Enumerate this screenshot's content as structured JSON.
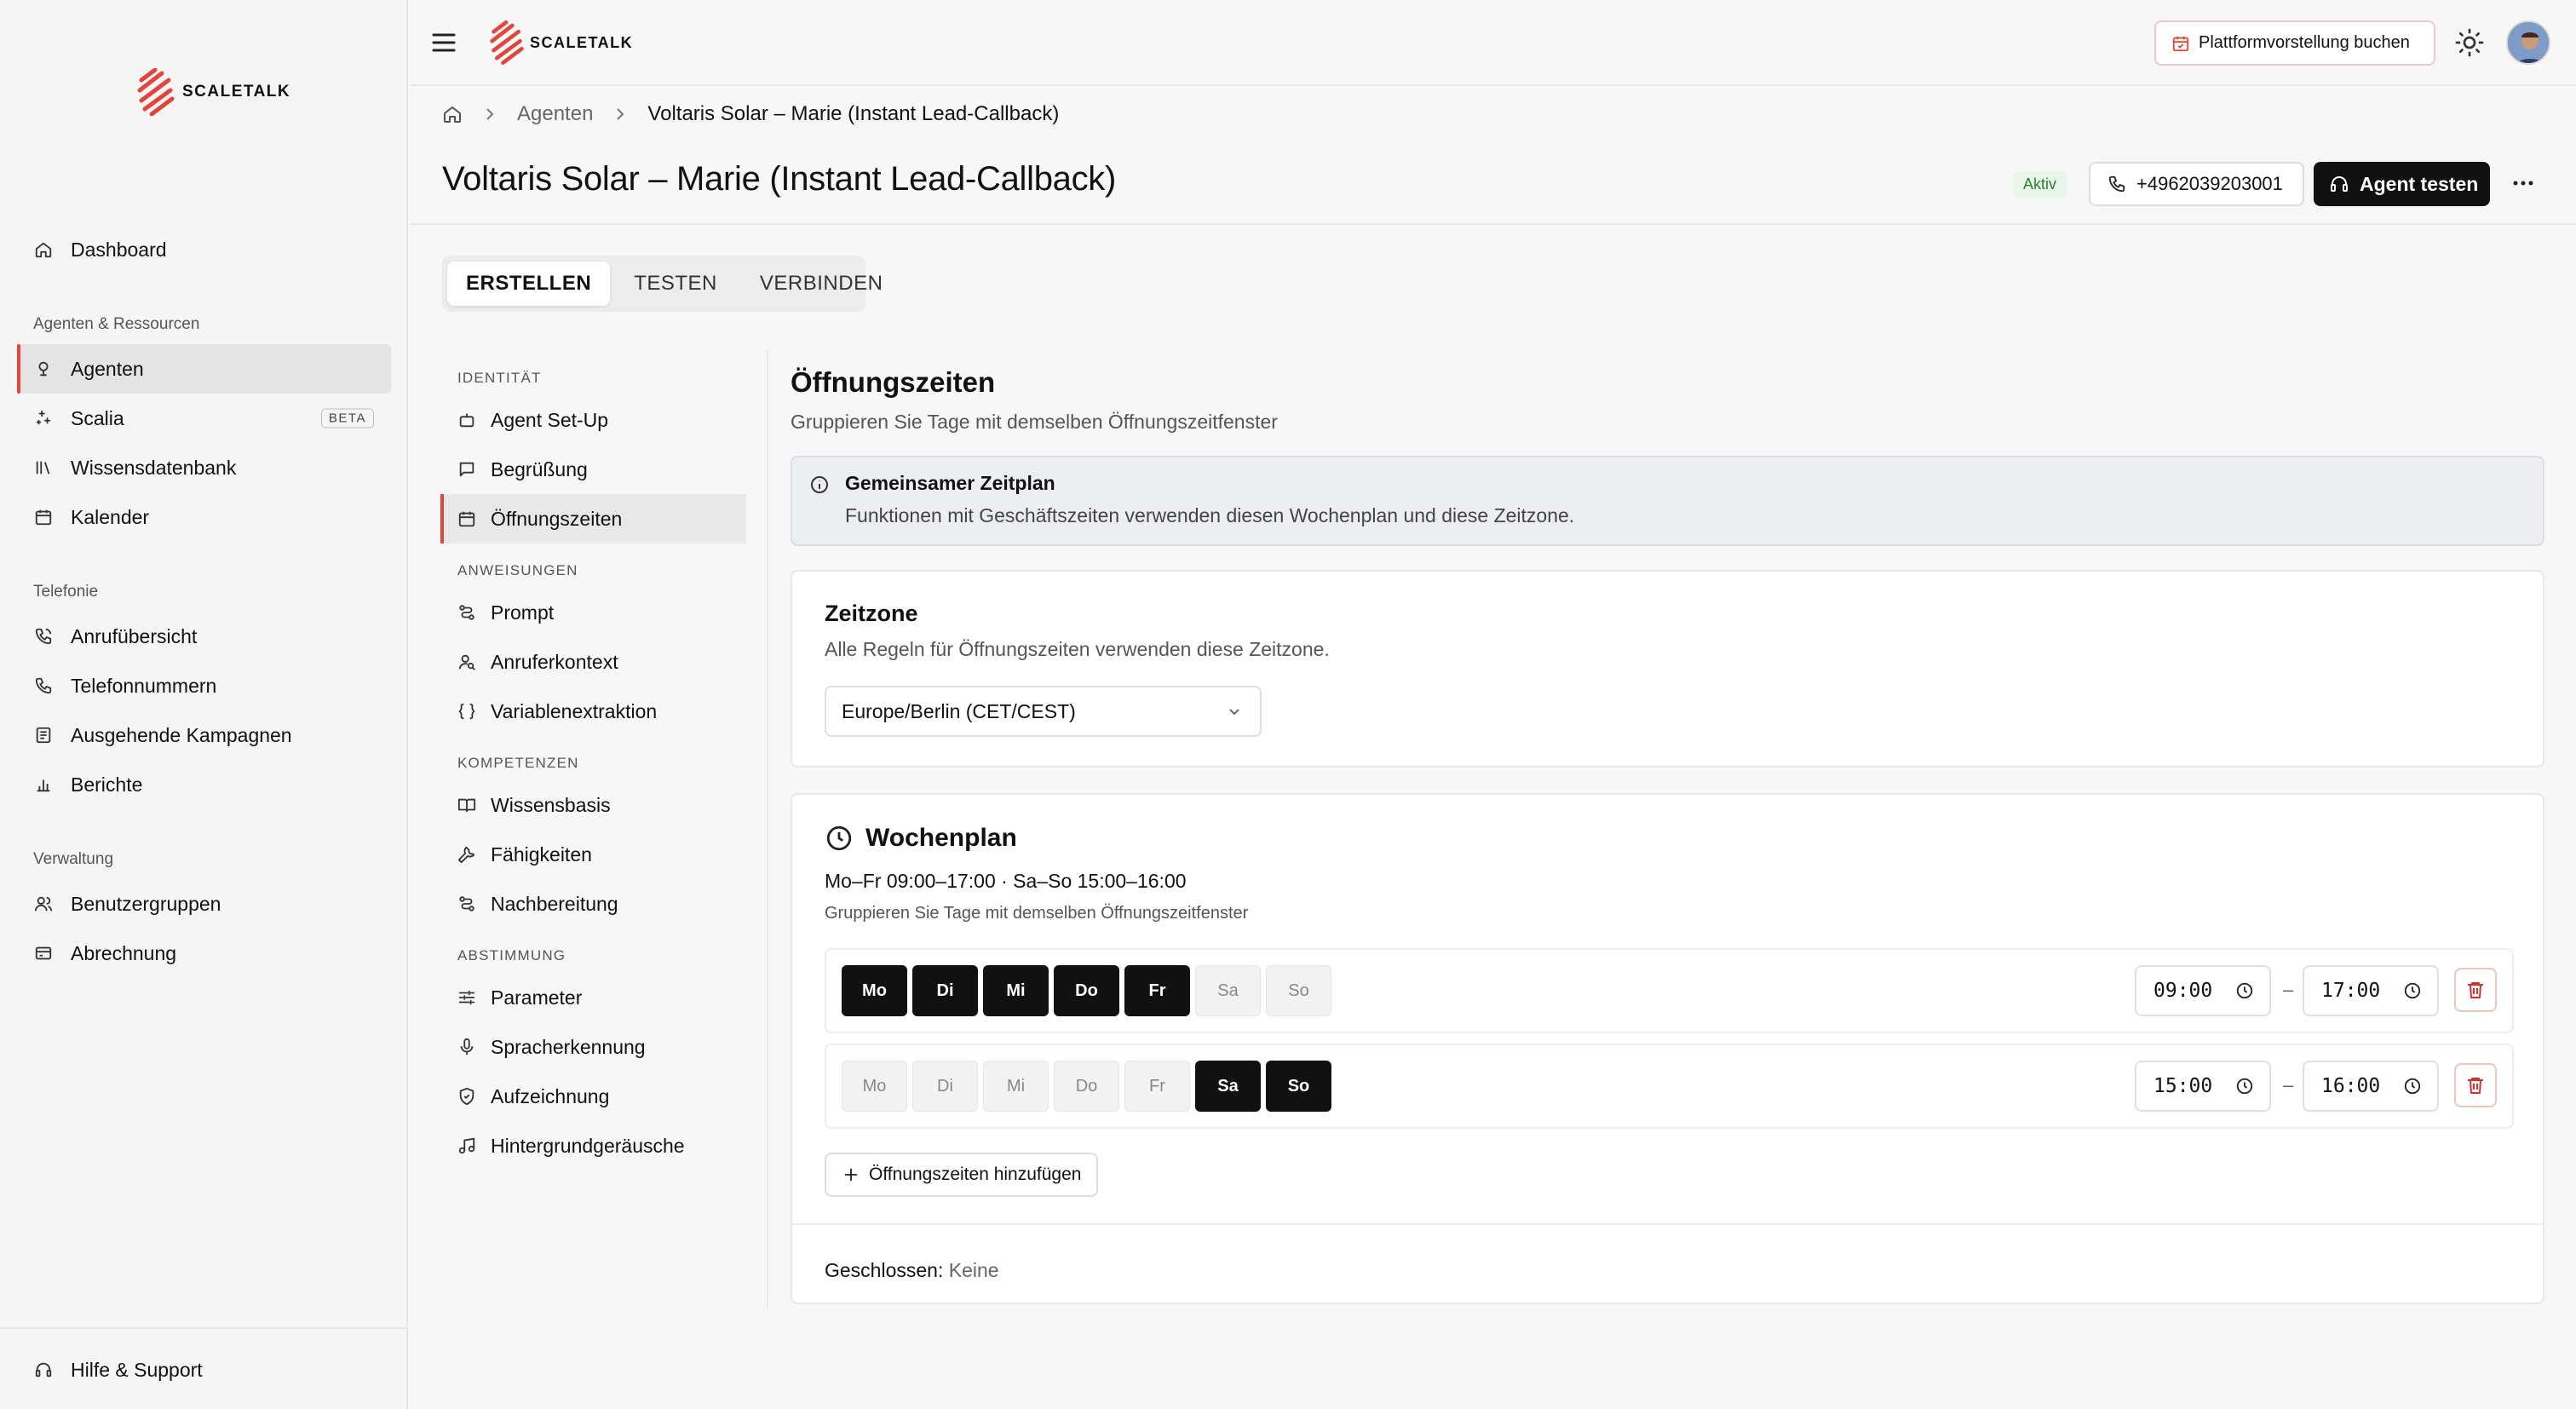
{
  "brand": {
    "name": "SCALETALK",
    "accent": "#e2453b"
  },
  "sidebar": {
    "items": [
      {
        "label": "Dashboard",
        "icon": "home-icon"
      }
    ],
    "sections": [
      {
        "title": "Agenten & Ressourcen",
        "items": [
          {
            "label": "Agenten",
            "icon": "bot-icon",
            "active": true
          },
          {
            "label": "Scalia",
            "icon": "sparkles-icon",
            "badge": "BETA"
          },
          {
            "label": "Wissensdatenbank",
            "icon": "library-icon"
          },
          {
            "label": "Kalender",
            "icon": "calendar-icon"
          }
        ]
      },
      {
        "title": "Telefonie",
        "items": [
          {
            "label": "Anrufübersicht",
            "icon": "phone-call-icon"
          },
          {
            "label": "Telefonnummern",
            "icon": "phone-icon"
          },
          {
            "label": "Ausgehende Kampagnen",
            "icon": "campaign-icon"
          },
          {
            "label": "Berichte",
            "icon": "chart-icon"
          }
        ]
      },
      {
        "title": "Verwaltung",
        "items": [
          {
            "label": "Benutzergruppen",
            "icon": "users-icon"
          },
          {
            "label": "Abrechnung",
            "icon": "wallet-icon"
          }
        ]
      }
    ],
    "footer": {
      "label": "Hilfe & Support",
      "icon": "headset-icon"
    }
  },
  "topbar": {
    "demo_button": "Plattformvorstellung buchen"
  },
  "breadcrumb": {
    "items": [
      "Agenten",
      "Voltaris Solar – Marie (Instant Lead-Callback)"
    ]
  },
  "page": {
    "title": "Voltaris Solar – Marie (Instant Lead-Callback)",
    "status": "Aktiv",
    "phone": "+4962039203001",
    "test_button": "Agent testen"
  },
  "tabs": [
    {
      "label": "ERSTELLEN",
      "active": true
    },
    {
      "label": "TESTEN"
    },
    {
      "label": "VERBINDEN"
    }
  ],
  "subnav": {
    "sections": [
      {
        "title": "IDENTITÄT",
        "items": [
          {
            "label": "Agent Set-Up",
            "icon": "bot-icon"
          },
          {
            "label": "Begrüßung",
            "icon": "message-icon"
          },
          {
            "label": "Öffnungszeiten",
            "icon": "calendar-icon",
            "active": true
          }
        ]
      },
      {
        "title": "ANWEISUNGEN",
        "items": [
          {
            "label": "Prompt",
            "icon": "route-icon"
          },
          {
            "label": "Anruferkontext",
            "icon": "user-search-icon"
          },
          {
            "label": "Variablenextraktion",
            "icon": "braces-icon"
          }
        ]
      },
      {
        "title": "KOMPETENZEN",
        "items": [
          {
            "label": "Wissensbasis",
            "icon": "book-icon"
          },
          {
            "label": "Fähigkeiten",
            "icon": "wrench-icon"
          },
          {
            "label": "Nachbereitung",
            "icon": "route-icon"
          }
        ]
      },
      {
        "title": "ABSTIMMUNG",
        "items": [
          {
            "label": "Parameter",
            "icon": "sliders-icon"
          },
          {
            "label": "Spracherkennung",
            "icon": "mic-icon"
          },
          {
            "label": "Aufzeichnung",
            "icon": "shield-icon"
          },
          {
            "label": "Hintergrundgeräusche",
            "icon": "music-icon"
          }
        ]
      }
    ]
  },
  "hours": {
    "title": "Öffnungszeiten",
    "subtitle": "Gruppieren Sie Tage mit demselben Öffnungszeitfenster",
    "info": {
      "title": "Gemeinsamer Zeitplan",
      "text": "Funktionen mit Geschäftszeiten verwenden diesen Wochenplan und diese Zeitzone."
    },
    "timezone": {
      "title": "Zeitzone",
      "subtitle": "Alle Regeln für Öffnungszeiten verwenden diese Zeitzone.",
      "value": "Europe/Berlin (CET/CEST)"
    },
    "week": {
      "title": "Wochenplan",
      "summary": "Mo–Fr 09:00–17:00 · Sa–So 15:00–16:00",
      "hint": "Gruppieren Sie Tage mit demselben Öffnungszeitfenster",
      "separator": "–",
      "rows": [
        {
          "days": [
            {
              "label": "Mo",
              "on": true
            },
            {
              "label": "Di",
              "on": true
            },
            {
              "label": "Mi",
              "on": true
            },
            {
              "label": "Do",
              "on": true
            },
            {
              "label": "Fr",
              "on": true
            },
            {
              "label": "Sa",
              "on": false
            },
            {
              "label": "So",
              "on": false
            }
          ],
          "from": "09:00",
          "to": "17:00"
        },
        {
          "days": [
            {
              "label": "Mo",
              "on": false
            },
            {
              "label": "Di",
              "on": false
            },
            {
              "label": "Mi",
              "on": false
            },
            {
              "label": "Do",
              "on": false
            },
            {
              "label": "Fr",
              "on": false
            },
            {
              "label": "Sa",
              "on": true
            },
            {
              "label": "So",
              "on": true
            }
          ],
          "from": "15:00",
          "to": "16:00"
        }
      ],
      "add_button": "Öffnungszeiten hinzufügen",
      "closed_label": "Geschlossen:",
      "closed_value": "Keine"
    }
  }
}
